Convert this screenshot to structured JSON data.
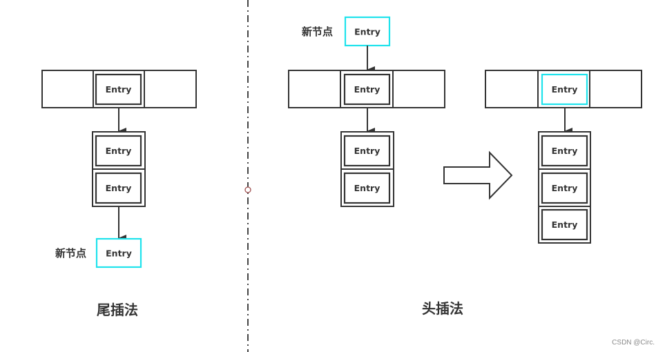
{
  "diagram": {
    "left_panel": {
      "title": "尾插法",
      "array_entry": "Entry",
      "chain": [
        "Entry",
        "Entry"
      ],
      "new_node_label": "新节点",
      "new_node_entry": "Entry"
    },
    "right_panel": {
      "title": "头插法",
      "before": {
        "new_node_label": "新节点",
        "new_node_entry": "Entry",
        "array_entry": "Entry",
        "chain": [
          "Entry",
          "Entry"
        ]
      },
      "after": {
        "array_entry": "Entry",
        "chain": [
          "Entry",
          "Entry",
          "Entry"
        ]
      }
    },
    "colors": {
      "stroke": "#333333",
      "new_node_highlight": "#1ee3ec",
      "divider_handle": "#a05050"
    }
  },
  "watermark": "CSDN @Circ."
}
